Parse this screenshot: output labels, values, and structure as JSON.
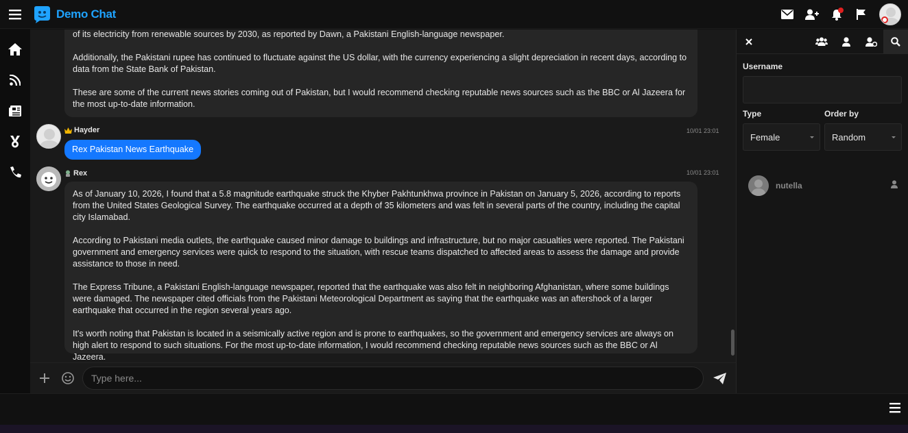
{
  "app": {
    "name": "Demo Chat"
  },
  "messages": [
    {
      "id": "prev",
      "author": "",
      "paragraphs": [
        "of its electricity from renewable sources by 2030, as reported by Dawn, a Pakistani English-language newspaper.",
        "Additionally, the Pakistani rupee has continued to fluctuate against the US dollar, with the currency experiencing a slight depreciation in recent days, according to data from the State Bank of Pakistan.",
        "These are some of the current news stories coming out of Pakistan, but I would recommend checking reputable news sources such as the BBC or Al Jazeera for the most up-to-date information."
      ]
    },
    {
      "id": "hayder",
      "author": "Hayder",
      "time": "10/01 23:01",
      "text": "Rex Pakistan News Earthquake"
    },
    {
      "id": "rex",
      "author": "Rex",
      "time": "10/01 23:01",
      "paragraphs": [
        "As of January 10, 2026, I found that a 5.8 magnitude earthquake struck the Khyber Pakhtunkhwa province in Pakistan on January 5, 2026, according to reports from the United States Geological Survey. The earthquake occurred at a depth of 35 kilometers and was felt in several parts of the country, including the capital city Islamabad.",
        "According to Pakistani media outlets, the earthquake caused minor damage to buildings and infrastructure, but no major casualties were reported. The Pakistani government and emergency services were quick to respond to the situation, with rescue teams dispatched to affected areas to assess the damage and provide assistance to those in need.",
        "The Express Tribune, a Pakistani English-language newspaper, reported that the earthquake was also felt in neighboring Afghanistan, where some buildings were damaged. The newspaper cited officials from the Pakistani Meteorological Department as saying that the earthquake was an aftershock of a larger earthquake that occurred in the region several years ago.",
        "It's worth noting that Pakistan is located in a seismically active region and is prone to earthquakes, so the government and emergency services are always on high alert to respond to such situations. For the most up-to-date information, I would recommend checking reputable news sources such as the BBC or Al Jazeera."
      ]
    }
  ],
  "input": {
    "placeholder": "Type here..."
  },
  "panel": {
    "username_label": "Username",
    "type_label": "Type",
    "type_value": "Female",
    "order_label": "Order by",
    "order_value": "Random",
    "users": [
      {
        "name": "nutella"
      }
    ]
  },
  "colors": {
    "brand": "#1fa3ff",
    "user_bubble": "#1478ff",
    "notification": "#e02020"
  }
}
